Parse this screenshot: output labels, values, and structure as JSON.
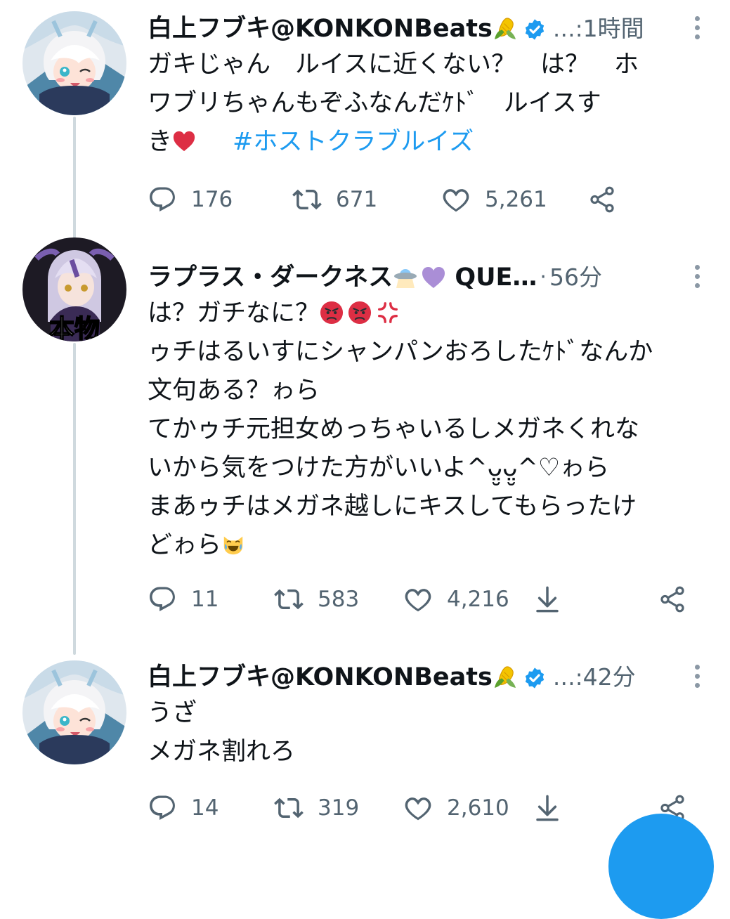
{
  "tweets": [
    {
      "author": "白上フブキ@KONKONBeats",
      "handle": "…:",
      "time": "1時間",
      "lines": [
        "ガキじゃん　ルイスに近くない？　は？　ホ",
        "ワブリちゃんもぞふなんだｹﾄﾞ　ルイスす",
        "き"
      ],
      "hashtag": "#ホストクラブルイズ",
      "replies": "176",
      "retweets": "671",
      "likes": "5,261"
    },
    {
      "author": "ラプラス・ダークネス",
      "author_suffix": "QUE…",
      "time": "56分",
      "lines": [
        "は？ガチなに？",
        "ゥチはるいすにシャンパンおろしたｹﾄﾞなんか",
        "文句ある？ゎら",
        "てかゥチ元担女めっちゃいるしメガネくれな",
        "いから気をつけた方がいいよ^ᴗ̤̮ᴗ̤̮^♡ゎら",
        "まあゥチはメガネ越しにキスしてもらったけ",
        "どゎら"
      ],
      "replies": "11",
      "retweets": "583",
      "likes": "4,216"
    },
    {
      "author": "白上フブキ@KONKONBeats",
      "handle": "…:",
      "time": "42分",
      "lines": [
        "うざ",
        "メガネ割れろ"
      ],
      "replies": "14",
      "retweets": "319",
      "likes": "2,610"
    }
  ],
  "avatar_caption": "本物",
  "icons": {
    "reply": "reply-icon",
    "retweet": "retweet-icon",
    "like": "heart-icon",
    "share": "share-icon",
    "download": "download-arrow-icon",
    "verified": "verified-badge-icon",
    "corn": "corn-emoji-icon"
  },
  "colors": {
    "accent": "#1d9bf0",
    "muted": "#536471",
    "thread": "#cfd9de"
  }
}
